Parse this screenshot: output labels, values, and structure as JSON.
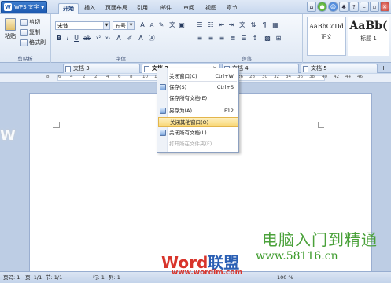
{
  "app": {
    "title": "WPS 文字"
  },
  "menu_tabs": [
    "开始",
    "插入",
    "页面布局",
    "引用",
    "邮件",
    "审阅",
    "视图",
    "章节"
  ],
  "ribbon": {
    "clipboard": {
      "paste": "粘贴",
      "cut": "剪切",
      "copy": "复制",
      "format_painter": "格式刷",
      "label": "剪贴板"
    },
    "font": {
      "name": "宋体",
      "size": "五号",
      "label": "字体"
    },
    "paragraph": {
      "label": "段落"
    },
    "styles": [
      {
        "sample": "AaBbCcDd",
        "name": "正文"
      },
      {
        "sample": "AaBb(",
        "name": "标题 1"
      }
    ]
  },
  "doc_tabs": [
    "文档 3",
    "文档 2",
    "文档 4",
    "文档 5"
  ],
  "ruler_numbers": [
    "8",
    "6",
    "4",
    "2",
    "2",
    "4",
    "6",
    "8",
    "10",
    "12",
    "14",
    "16",
    "18",
    "20",
    "22",
    "24",
    "26",
    "28",
    "30",
    "32",
    "34",
    "36",
    "38",
    "40",
    "42",
    "44",
    "46"
  ],
  "context_menu": [
    {
      "label": "关闭窗口(C)",
      "shortcut": "Ctrl+W",
      "state": "normal",
      "icon": false
    },
    {
      "label": "保存(S)",
      "shortcut": "Ctrl+S",
      "state": "normal",
      "icon": true
    },
    {
      "label": "保存所有文档(E)",
      "shortcut": "",
      "state": "normal",
      "icon": false
    },
    {
      "label": "另存为(A)...",
      "shortcut": "F12",
      "state": "normal",
      "icon": true
    },
    {
      "label": "关闭其他窗口(O)",
      "shortcut": "",
      "state": "highlighted",
      "icon": false
    },
    {
      "label": "关闭所有文档(L)",
      "shortcut": "",
      "state": "normal",
      "icon": true
    },
    {
      "label": "打开所在文件夹(F)",
      "shortcut": "",
      "state": "disabled",
      "icon": false
    }
  ],
  "status": {
    "page": "页码: 1",
    "pages": "页: 1/1",
    "section": "节: 1/1",
    "row": "行: 1",
    "col": "列: 1",
    "zoom": "100 %"
  },
  "watermark": {
    "slogan": "电脑入门到精通",
    "url": "www.58116.cn",
    "logo_word": "Word",
    "logo_cn": "联盟",
    "site": "www.wordlm.com",
    "side": "W"
  }
}
